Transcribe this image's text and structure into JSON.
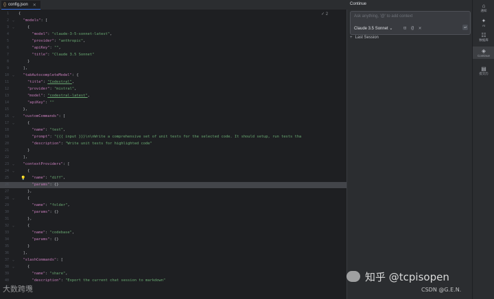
{
  "tab": {
    "name": "config.json"
  },
  "editor": {
    "inspection_hint": "✓ 2",
    "lines": [
      {
        "n": "1",
        "t": [
          [
            "p",
            "{"
          ]
        ]
      },
      {
        "n": "2",
        "t": [
          [
            "p",
            "  "
          ],
          [
            "k",
            "\"models\""
          ],
          [
            "p",
            ": ["
          ]
        ]
      },
      {
        "n": "3",
        "t": [
          [
            "p",
            "    {"
          ]
        ]
      },
      {
        "n": "4",
        "t": [
          [
            "p",
            "      "
          ],
          [
            "k",
            "\"model\""
          ],
          [
            "p",
            ": "
          ],
          [
            "s",
            "\"claude-3-5-sonnet-latest\""
          ],
          [
            "p",
            ","
          ]
        ]
      },
      {
        "n": "5",
        "t": [
          [
            "p",
            "      "
          ],
          [
            "k",
            "\"provider\""
          ],
          [
            "p",
            ": "
          ],
          [
            "s",
            "\"anthropic\""
          ],
          [
            "p",
            ","
          ]
        ]
      },
      {
        "n": "6",
        "t": [
          [
            "p",
            "      "
          ],
          [
            "k",
            "\"apiKey\""
          ],
          [
            "p",
            ": "
          ],
          [
            "s",
            "\"\""
          ],
          [
            "p",
            ","
          ]
        ]
      },
      {
        "n": "7",
        "t": [
          [
            "p",
            "      "
          ],
          [
            "k",
            "\"title\""
          ],
          [
            "p",
            ": "
          ],
          [
            "s",
            "\"Claude 3.5 Sonnet\""
          ]
        ]
      },
      {
        "n": "8",
        "t": [
          [
            "p",
            "    }"
          ]
        ]
      },
      {
        "n": "9",
        "t": [
          [
            "p",
            "  ],"
          ]
        ]
      },
      {
        "n": "10",
        "t": [
          [
            "p",
            "  "
          ],
          [
            "k",
            "\"tabAutocompleteModel\""
          ],
          [
            "p",
            ": {"
          ]
        ]
      },
      {
        "n": "11",
        "t": [
          [
            "p",
            "    "
          ],
          [
            "k",
            "\"title\""
          ],
          [
            "p",
            ": "
          ],
          [
            "s",
            "\"Codestral\""
          ],
          [
            "p",
            ","
          ]
        ]
      },
      {
        "n": "12",
        "t": [
          [
            "p",
            "    "
          ],
          [
            "k",
            "\"provider\""
          ],
          [
            "p",
            ": "
          ],
          [
            "s",
            "\"mistral\""
          ],
          [
            "p",
            ","
          ]
        ]
      },
      {
        "n": "13",
        "t": [
          [
            "p",
            "    "
          ],
          [
            "k",
            "\"model\""
          ],
          [
            "p",
            ": "
          ],
          [
            "s",
            "\"codestral-latest\""
          ],
          [
            "p",
            ","
          ]
        ]
      },
      {
        "n": "14",
        "t": [
          [
            "p",
            "    "
          ],
          [
            "k",
            "\"apiKey\""
          ],
          [
            "p",
            ": "
          ],
          [
            "s",
            "\"\""
          ]
        ]
      },
      {
        "n": "15",
        "t": [
          [
            "p",
            "  },"
          ]
        ]
      },
      {
        "n": "16",
        "t": [
          [
            "p",
            "  "
          ],
          [
            "k",
            "\"customCommands\""
          ],
          [
            "p",
            ": ["
          ]
        ]
      },
      {
        "n": "17",
        "t": [
          [
            "p",
            "    {"
          ]
        ]
      },
      {
        "n": "18",
        "t": [
          [
            "p",
            "      "
          ],
          [
            "k",
            "\"name\""
          ],
          [
            "p",
            ": "
          ],
          [
            "s",
            "\"test\""
          ],
          [
            "p",
            ","
          ]
        ]
      },
      {
        "n": "19",
        "t": [
          [
            "p",
            "      "
          ],
          [
            "k",
            "\"prompt\""
          ],
          [
            "p",
            ": "
          ],
          [
            "s",
            "\"{{{ input }}}\\n\\nWrite a comprehensive set of unit tests for the selected code. It should setup, run tests tha"
          ]
        ]
      },
      {
        "n": "20",
        "t": [
          [
            "p",
            "      "
          ],
          [
            "k",
            "\"description\""
          ],
          [
            "p",
            ": "
          ],
          [
            "s",
            "\"Write unit tests for highlighted code\""
          ]
        ]
      },
      {
        "n": "21",
        "t": [
          [
            "p",
            "    }"
          ]
        ]
      },
      {
        "n": "22",
        "t": [
          [
            "p",
            "  ],"
          ]
        ]
      },
      {
        "n": "23",
        "t": [
          [
            "p",
            "  "
          ],
          [
            "k",
            "\"contextProviders\""
          ],
          [
            "p",
            ": ["
          ]
        ]
      },
      {
        "n": "24",
        "t": [
          [
            "p",
            "    {"
          ]
        ]
      },
      {
        "n": "25",
        "t": [
          [
            "p",
            "      "
          ],
          [
            "k",
            "\"name\""
          ],
          [
            "p",
            ": "
          ],
          [
            "s",
            "\"diff\""
          ],
          [
            "p",
            ","
          ]
        ]
      },
      {
        "n": "26",
        "t": [
          [
            "p",
            "      "
          ],
          [
            "k",
            "\"params\""
          ],
          [
            "p",
            ": "
          ],
          [
            "p",
            "{}"
          ]
        ]
      },
      {
        "n": "27",
        "t": [
          [
            "p",
            "    },"
          ]
        ]
      },
      {
        "n": "28",
        "t": [
          [
            "p",
            "    {"
          ]
        ]
      },
      {
        "n": "29",
        "t": [
          [
            "p",
            "      "
          ],
          [
            "k",
            "\"name\""
          ],
          [
            "p",
            ": "
          ],
          [
            "s",
            "\"folder\""
          ],
          [
            "p",
            ","
          ]
        ]
      },
      {
        "n": "30",
        "t": [
          [
            "p",
            "      "
          ],
          [
            "k",
            "\"params\""
          ],
          [
            "p",
            ": {}"
          ]
        ]
      },
      {
        "n": "31",
        "t": [
          [
            "p",
            "    },"
          ]
        ]
      },
      {
        "n": "32",
        "t": [
          [
            "p",
            "    {"
          ]
        ]
      },
      {
        "n": "33",
        "t": [
          [
            "p",
            "      "
          ],
          [
            "k",
            "\"name\""
          ],
          [
            "p",
            ": "
          ],
          [
            "s",
            "\"codebase\""
          ],
          [
            "p",
            ","
          ]
        ]
      },
      {
        "n": "34",
        "t": [
          [
            "p",
            "      "
          ],
          [
            "k",
            "\"params\""
          ],
          [
            "p",
            ": {}"
          ]
        ]
      },
      {
        "n": "35",
        "t": [
          [
            "p",
            "    }"
          ]
        ]
      },
      {
        "n": "36",
        "t": [
          [
            "p",
            "  ],"
          ]
        ]
      },
      {
        "n": "37",
        "t": [
          [
            "p",
            "  "
          ],
          [
            "k",
            "\"slashCommands\""
          ],
          [
            "p",
            ": ["
          ]
        ]
      },
      {
        "n": "38",
        "t": [
          [
            "p",
            "    {"
          ]
        ]
      },
      {
        "n": "39",
        "t": [
          [
            "p",
            "      "
          ],
          [
            "k",
            "\"name\""
          ],
          [
            "p",
            ": "
          ],
          [
            "s",
            "\"share\""
          ],
          [
            "p",
            ","
          ]
        ]
      },
      {
        "n": "40",
        "t": [
          [
            "p",
            "      "
          ],
          [
            "k",
            "\"description\""
          ],
          [
            "p",
            ": "
          ],
          [
            "s",
            "\"Export the current chat session to markdown\""
          ]
        ]
      },
      {
        "n": "41",
        "t": [
          [
            "p",
            "    },"
          ]
        ]
      }
    ]
  },
  "panel": {
    "title": "Continue",
    "placeholder": "Ask anything, '@' to add context",
    "model_selector": "Claude 3.5 Sonnet",
    "last_session": "Last Session"
  },
  "rail": {
    "items": [
      {
        "glyph": "⌂",
        "label": "通知",
        "name": "notifications-icon"
      },
      {
        "glyph": "✦",
        "label": "AI",
        "name": "ai-assistant-icon"
      },
      {
        "glyph": "☷",
        "label": "数据库",
        "name": "database-icon"
      },
      {
        "glyph": "◈",
        "label": "Continue",
        "name": "continue-icon"
      },
      {
        "glyph": "▤",
        "label": "提交历",
        "name": "commit-history-icon"
      }
    ]
  },
  "watermarks": {
    "left": "大数跨境",
    "right_main": "知乎 @tcpisopen",
    "right_sub": "CSDN @G.E.N."
  },
  "colors": {
    "keyword": "#c77dbb",
    "string": "#6aab73",
    "accent": "#3574f0",
    "background": "#1e1f22"
  }
}
